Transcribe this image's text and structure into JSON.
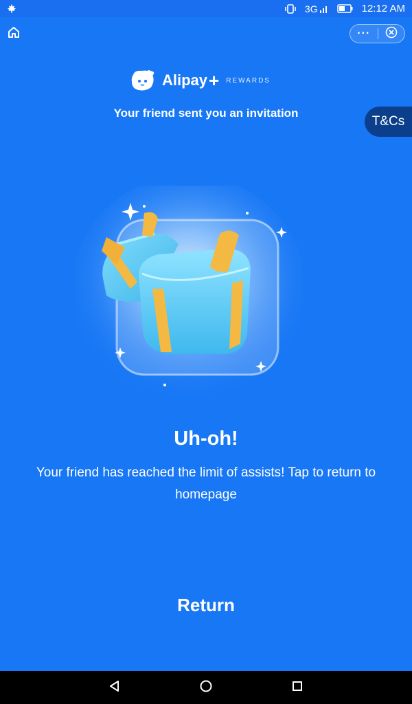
{
  "status_bar": {
    "network": "3G",
    "time": "12:12 AM"
  },
  "header": {
    "more_label": "···",
    "brand": "Alipay",
    "plus": "+",
    "rewards": "REWARDS"
  },
  "invite_text": "Your friend sent you an invitation",
  "tnc_label": "T&Cs",
  "main": {
    "title": "Uh-oh!",
    "message": "Your friend has reached the limit of assists! Tap to return to homepage",
    "return_label": "Return"
  },
  "colors": {
    "background": "#1877f5",
    "tnc_tab": "#0b3f8c",
    "gift_box": "#5fd0f2",
    "ribbon": "#f4b942"
  },
  "icons": {
    "home": "home-icon",
    "close": "close-circle-icon",
    "back": "back-triangle-icon",
    "home_nav": "home-circle-icon",
    "recents": "recents-square-icon"
  }
}
